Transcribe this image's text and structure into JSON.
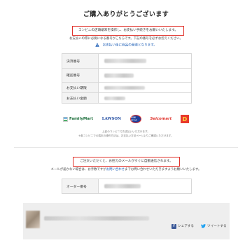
{
  "page": {
    "title": "ご購入ありがとうございます"
  },
  "alert1": {
    "text": "コンビニの店頭端末を操作し、お支払い手続きをお願いいたします。"
  },
  "sub1": "お支払いの際に必要になる番号がこちらです。下記の番号を必ずお控えください。",
  "notice": "お支払い後に商品の発送となります。",
  "payment_table": {
    "rows": [
      {
        "label": "決済番号"
      },
      {
        "label": "確認番号"
      },
      {
        "label": "お支払い期限"
      },
      {
        "label": "お支払い金額"
      }
    ]
  },
  "logos": {
    "familymart": "FamilyMart",
    "lawson": "LAWSON",
    "ministop": "MINI STOP",
    "seicomart": "Seicomart",
    "daily": "D"
  },
  "small_note1": "上記のコンビニでお支払いいただけます。",
  "small_note2": "※各コンビニでの端末の操作方法は、お支払い方法ページよりご確認いただけます。",
  "alert2": {
    "text": "ご注文いただくと、お控えのメールがすぐに自動送信されます。"
  },
  "sub2": {
    "before": "メールが届かない場合は、お手数ですが",
    "link": "お問い合わせ",
    "after": "までお問い合わせいただきますようお願いいたします。"
  },
  "order_table": {
    "label": "オーダー番号"
  },
  "footer": {
    "facebook_label": "シェアする",
    "twitter_label": "ツイートする"
  },
  "colors": {
    "alert_border": "#e0322b",
    "link": "#1a5cb5",
    "facebook": "#3b5998",
    "twitter": "#1da1f2"
  }
}
